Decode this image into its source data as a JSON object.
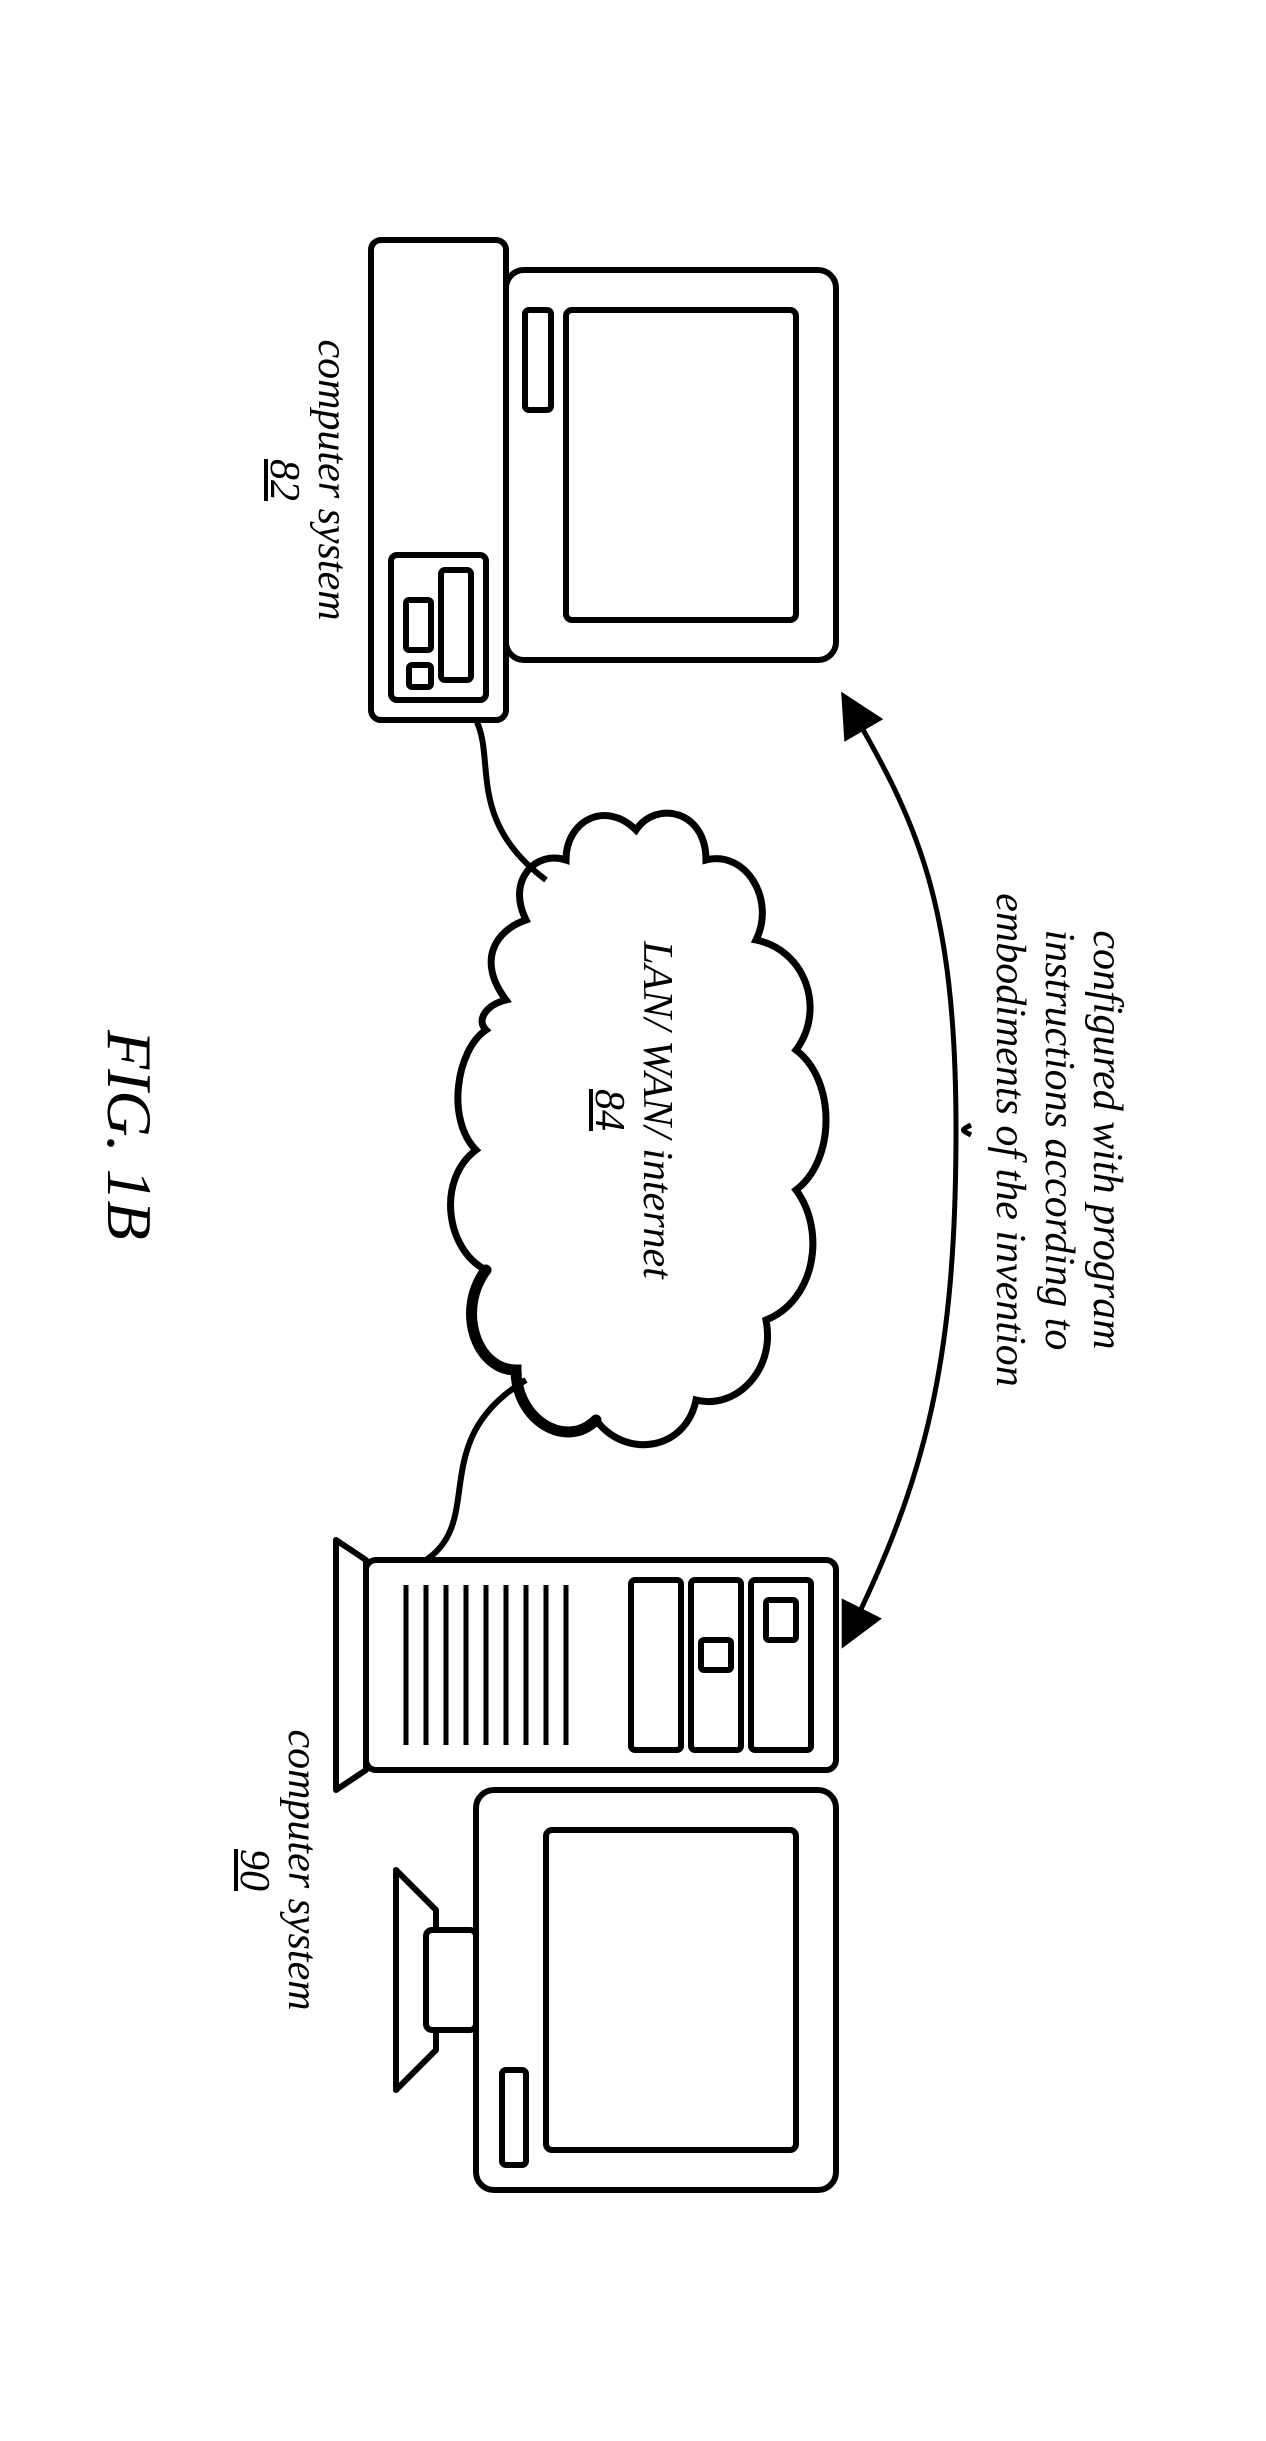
{
  "figure": {
    "id": "FIG. 1B",
    "caption_top_line1": "configured with program",
    "caption_top_line2": "instructions according to",
    "caption_top_line3": "embodiments of the invention",
    "cloud": {
      "label": "LAN/ WAN/ internet",
      "ref": "84"
    },
    "computer_left": {
      "label": "computer system",
      "ref": "82"
    },
    "computer_right": {
      "label": "computer system",
      "ref": "90"
    }
  }
}
